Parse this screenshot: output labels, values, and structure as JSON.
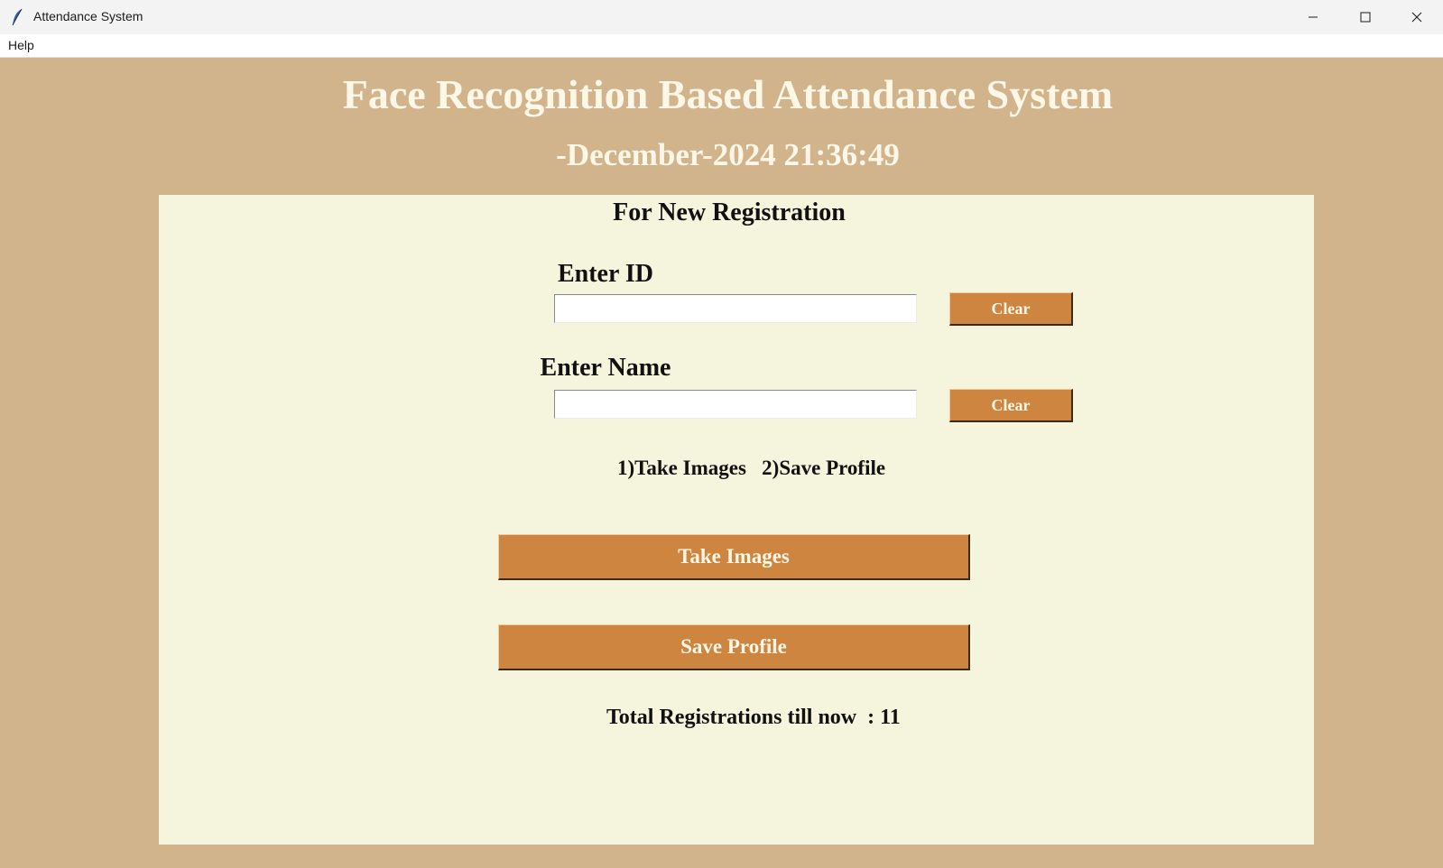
{
  "window": {
    "title": "Attendance System",
    "app_icon": "feather-icon",
    "controls": [
      "minimize-icon",
      "maximize-icon",
      "close-icon"
    ]
  },
  "menu": {
    "items": [
      {
        "label": "Help"
      }
    ]
  },
  "header": {
    "title": "Face Recognition Based Attendance System",
    "date": "-December-2024",
    "time": "21:36:49"
  },
  "registration": {
    "heading": "For New Registration",
    "id_label": "Enter ID",
    "id_value": "",
    "name_label": "Enter Name",
    "name_value": "",
    "clear_label": "Clear",
    "instructions": "1)Take Images   2)Save Profile",
    "take_images_label": "Take Images",
    "save_profile_label": "Save Profile",
    "total_text": "Total Registrations till now  : 11"
  },
  "colors": {
    "background": "#d2b48c",
    "panel": "#f5f4dc",
    "button": "#cd853f",
    "heading_text": "#fdf7e8"
  }
}
